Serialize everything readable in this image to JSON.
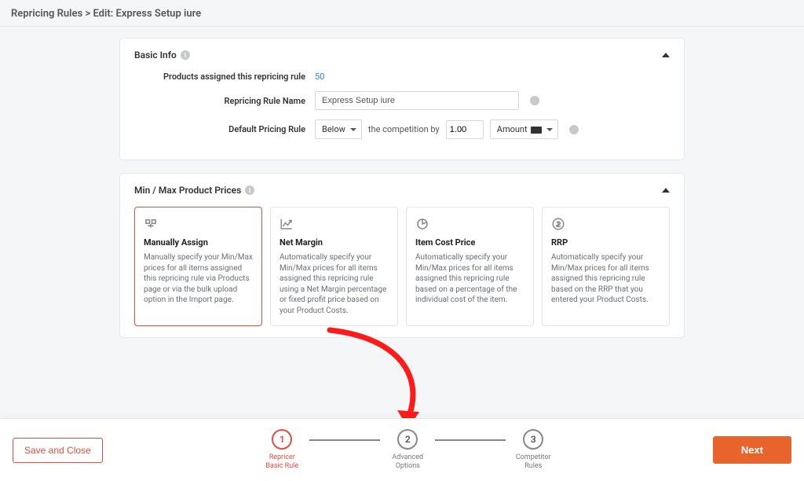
{
  "breadcrumb": {
    "root": "Repricing Rules",
    "separator": ">",
    "page": "Edit: Express Setup iure"
  },
  "basic_info": {
    "title": "Basic Info",
    "products_label": "Products assigned this repricing rule",
    "products_count": "50",
    "rule_name_label": "Repricing Rule Name",
    "rule_name_value": "Express Setup iure",
    "default_rule_label": "Default Pricing Rule",
    "position_select": "Below",
    "static_text": "the competition by",
    "amount_value": "1.00",
    "type_select": "Amount"
  },
  "minmax": {
    "title": "Min / Max Product Prices",
    "options": [
      {
        "title": "Manually Assign",
        "desc": "Manually specify your Min/Max prices for all items assigned this repricing rule via Products page or via the bulk upload option in the Import page."
      },
      {
        "title": "Net Margin",
        "desc": "Automatically specify your Min/Max prices for all items assigned this repricing rule using a Net Margin percentage or fixed profit price based on your Product Costs."
      },
      {
        "title": "Item Cost Price",
        "desc": "Automatically specify your Min/Max prices for all items assigned this repricing rule based on a percentage of the individual cost of the item."
      },
      {
        "title": "RRP",
        "desc": "Automatically specify your Min/Max prices for all items assigned this repricing rule based on the RRP that you entered your Product Costs."
      }
    ]
  },
  "footer": {
    "save_close": "Save and Close",
    "next": "Next",
    "steps": [
      {
        "num": "1",
        "label_l1": "Repricer",
        "label_l2": "Basic Rule"
      },
      {
        "num": "2",
        "label_l1": "Advanced",
        "label_l2": "Options"
      },
      {
        "num": "3",
        "label_l1": "Competitor",
        "label_l2": "Rules"
      }
    ]
  },
  "annotation": {
    "color": "#ff1a1a"
  }
}
